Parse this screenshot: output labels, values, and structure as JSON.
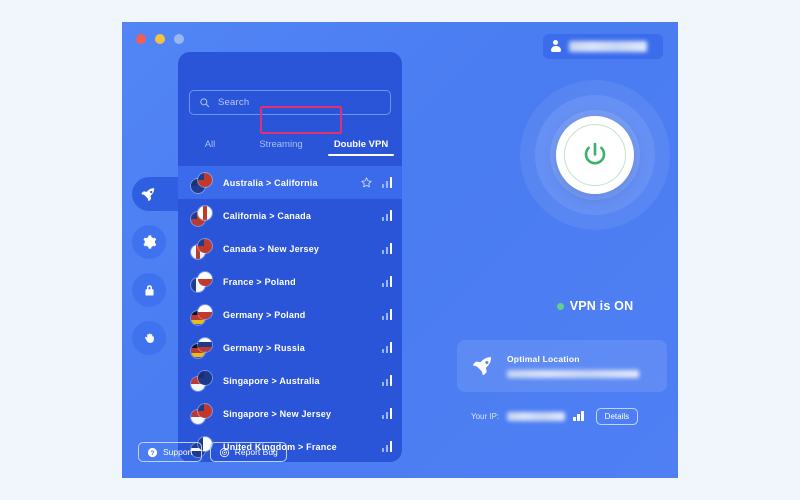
{
  "window": {
    "traffic_lights": [
      "close",
      "minimize",
      "zoom"
    ]
  },
  "account": {
    "icon": "person-icon",
    "username": "blurred"
  },
  "sidebar": {
    "items": [
      {
        "name": "rocket-icon",
        "label": "Connect",
        "active": true
      },
      {
        "name": "gear-icon",
        "label": "Settings",
        "active": false
      },
      {
        "name": "lock-icon",
        "label": "Security",
        "active": false
      },
      {
        "name": "hand-icon",
        "label": "Privacy",
        "active": false
      }
    ]
  },
  "search": {
    "icon": "search-icon",
    "placeholder": "Search",
    "value": ""
  },
  "tabs": [
    {
      "label": "All",
      "active": false
    },
    {
      "label": "Streaming",
      "active": false
    },
    {
      "label": "Double VPN",
      "active": true
    }
  ],
  "highlight": {
    "target": "Double VPN",
    "color": "#e1306c"
  },
  "servers": [
    {
      "label": "Australia > California",
      "selected": true,
      "favorite": false,
      "signal": 3,
      "flag_back": "au",
      "flag_front": "us"
    },
    {
      "label": "California > Canada",
      "selected": false,
      "favorite": false,
      "signal": 3,
      "flag_back": "us",
      "flag_front": "ca"
    },
    {
      "label": "Canada > New Jersey",
      "selected": false,
      "favorite": false,
      "signal": 3,
      "flag_back": "ca",
      "flag_front": "us"
    },
    {
      "label": "France > Poland",
      "selected": false,
      "favorite": false,
      "signal": 3,
      "flag_back": "fr",
      "flag_front": "pl"
    },
    {
      "label": "Germany > Poland",
      "selected": false,
      "favorite": false,
      "signal": 3,
      "flag_back": "de",
      "flag_front": "pl"
    },
    {
      "label": "Germany > Russia",
      "selected": false,
      "favorite": false,
      "signal": 3,
      "flag_back": "de",
      "flag_front": "ru"
    },
    {
      "label": "Singapore > Australia",
      "selected": false,
      "favorite": false,
      "signal": 3,
      "flag_back": "sg",
      "flag_front": "au"
    },
    {
      "label": "Singapore > New Jersey",
      "selected": false,
      "favorite": false,
      "signal": 3,
      "flag_back": "sg",
      "flag_front": "us"
    },
    {
      "label": "United Kingdom > France",
      "selected": false,
      "favorite": false,
      "signal": 3,
      "flag_back": "gb",
      "flag_front": "fr"
    }
  ],
  "power": {
    "icon": "power-icon",
    "accent": "#3faf6d"
  },
  "status": {
    "text": "VPN is ON",
    "dot_color": "#5fd18a"
  },
  "optimal": {
    "icon": "rocket-icon",
    "title": "Optimal Location",
    "subtitle": "blurred"
  },
  "ip": {
    "label": "Your IP:",
    "value": "blurred",
    "signal": 3,
    "details_label": "Details"
  },
  "footer": {
    "support_label": "Support",
    "support_icon": "question-circle-icon",
    "report_label": "Report Bug",
    "report_icon": "target-icon"
  }
}
